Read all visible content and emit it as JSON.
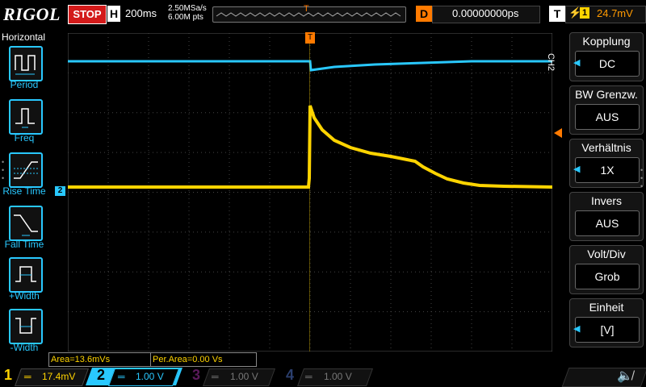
{
  "header": {
    "brand": "RIGOL",
    "run_state": "STOP",
    "timebase_key": "H",
    "timebase_value": "200ms",
    "sample_rate": "2.50MSa/s",
    "memory_depth": "6.00M pts",
    "trigger_marker": "T",
    "delay_key": "D",
    "delay_value": "0.00000000ps",
    "trigger_key": "T",
    "trigger_channel": "1",
    "trigger_level": "24.7mV"
  },
  "left_menu": {
    "title": "Horizontal",
    "items": [
      {
        "label": "Period",
        "icon": "period-icon"
      },
      {
        "label": "Freq",
        "icon": "frequency-icon"
      },
      {
        "label": "Rise Time",
        "icon": "rise-time-icon"
      },
      {
        "label": "Fall Time",
        "icon": "fall-time-icon"
      },
      {
        "label": "+Width",
        "icon": "positive-width-icon"
      },
      {
        "label": "-Width",
        "icon": "negative-width-icon"
      }
    ]
  },
  "right_menu": {
    "channel_tag": "CH2",
    "items": [
      {
        "title": "Kopplung",
        "value": "DC"
      },
      {
        "title": "BW Grenzw.",
        "value": "AUS"
      },
      {
        "title": "Verhältnis",
        "value": "1X"
      },
      {
        "title": "Invers",
        "value": "AUS"
      },
      {
        "title": "Volt/Div",
        "value": "Grob"
      },
      {
        "title": "Einheit",
        "value": "[V]"
      }
    ]
  },
  "measurements": {
    "area": "Area=13.6mVs",
    "per_area": "Per.Area=0.00 Vs"
  },
  "channels": [
    {
      "num": "1",
      "value": "17.4mV",
      "color": "#ffd400"
    },
    {
      "num": "2",
      "value": "1.00 V",
      "color": "#29c8ff"
    },
    {
      "num": "3",
      "value": "1.00 V",
      "color": "#b12bb1"
    },
    {
      "num": "4",
      "value": "1.00 V",
      "color": "#2f6bd6"
    }
  ],
  "markers": {
    "ch2_level": "2",
    "trigger_level": "T"
  },
  "colors": {
    "ch1": "#ffd400",
    "ch2": "#29c8ff",
    "trigger": "#ff7a00",
    "stop": "#d31a1a"
  }
}
